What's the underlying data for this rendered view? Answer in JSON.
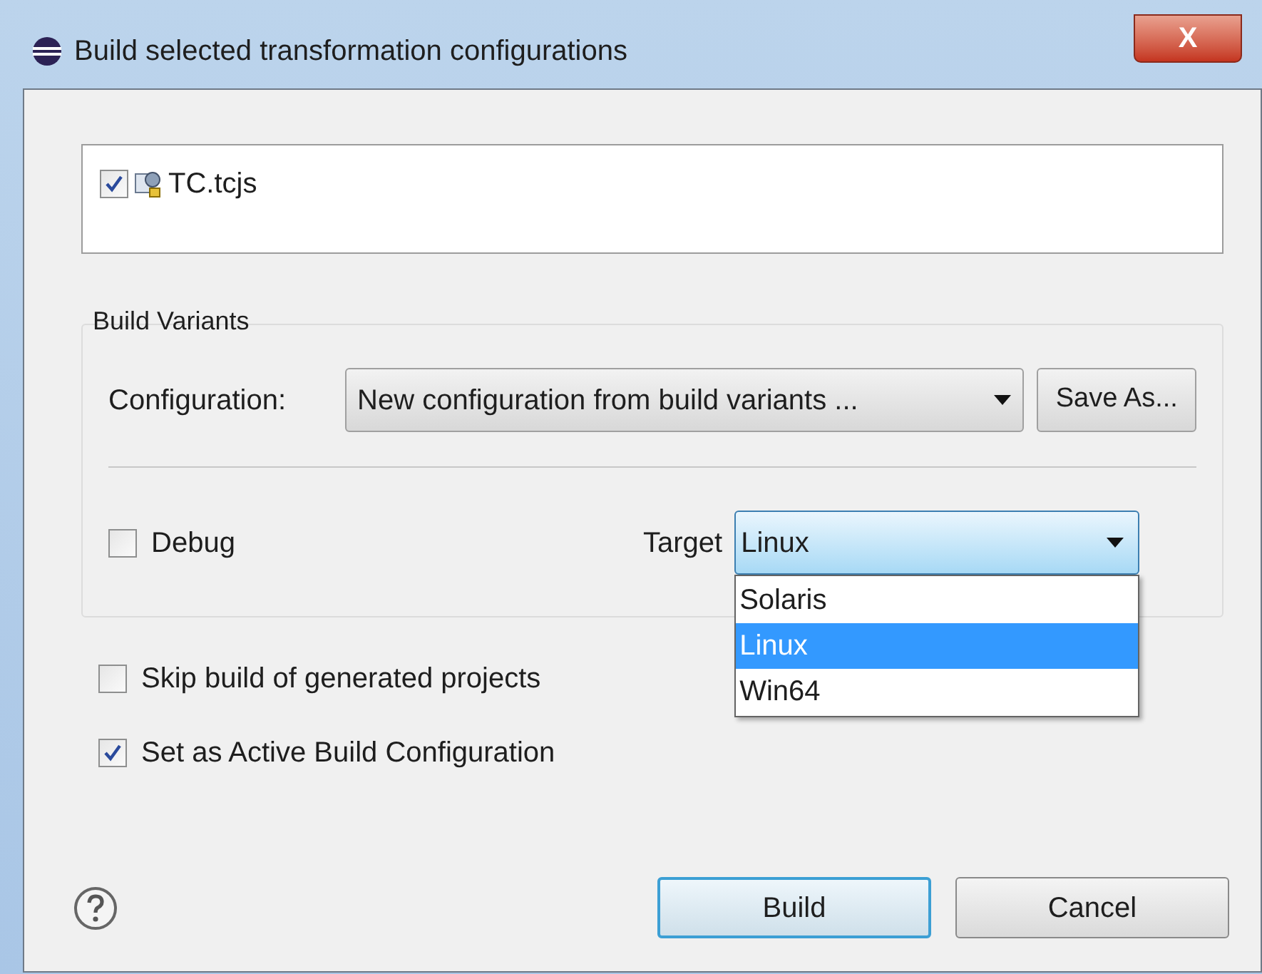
{
  "window": {
    "title": "Build selected transformation configurations",
    "close_label": "X"
  },
  "items": [
    {
      "label": "TC.tcjs",
      "checked": true
    }
  ],
  "build_variants": {
    "title": "Build Variants",
    "configuration": {
      "label": "Configuration:",
      "value": "New configuration from build variants ..."
    },
    "save_as": "Save As...",
    "debug": {
      "label": "Debug",
      "checked": false
    },
    "target": {
      "label": "Target",
      "value": "Linux",
      "expanded": true,
      "options": [
        {
          "label": "Solaris",
          "selected": false
        },
        {
          "label": "Linux",
          "selected": true
        },
        {
          "label": "Win64",
          "selected": false
        }
      ]
    }
  },
  "options": [
    {
      "label": "Skip build of generated projects",
      "checked": false
    },
    {
      "label": "Set as Active Build Configuration",
      "checked": true
    }
  ],
  "buttons": [
    {
      "label": "Build",
      "default": true
    },
    {
      "label": "Cancel",
      "default": false
    }
  ]
}
